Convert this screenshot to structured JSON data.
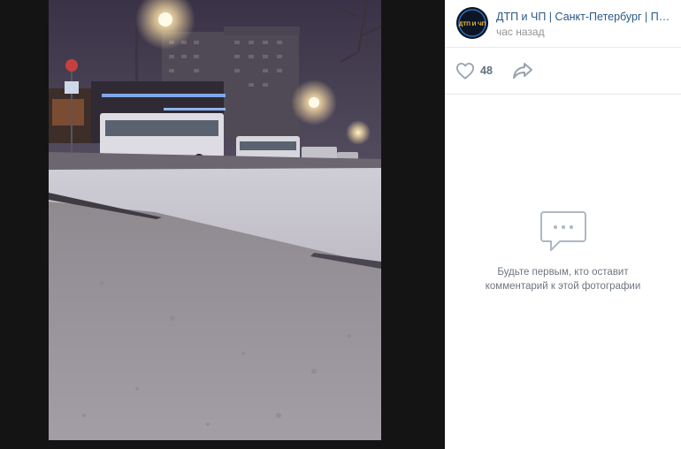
{
  "author": {
    "name": "ДТП и ЧП | Санкт-Петербург | Питер онлайн",
    "time": "час назад",
    "avatar_text": "ДТП И ЧП"
  },
  "actions": {
    "like_count": "48"
  },
  "comments": {
    "empty_text": "Будьте первым, кто оставит комментарий к этой фотографии"
  },
  "colors": {
    "link": "#2a5885",
    "muted": "#939393",
    "icon": "#99a2ad",
    "viewer_bg": "#141414"
  },
  "icons": [
    "heart-icon",
    "share-icon",
    "comment-bubble-icon"
  ]
}
